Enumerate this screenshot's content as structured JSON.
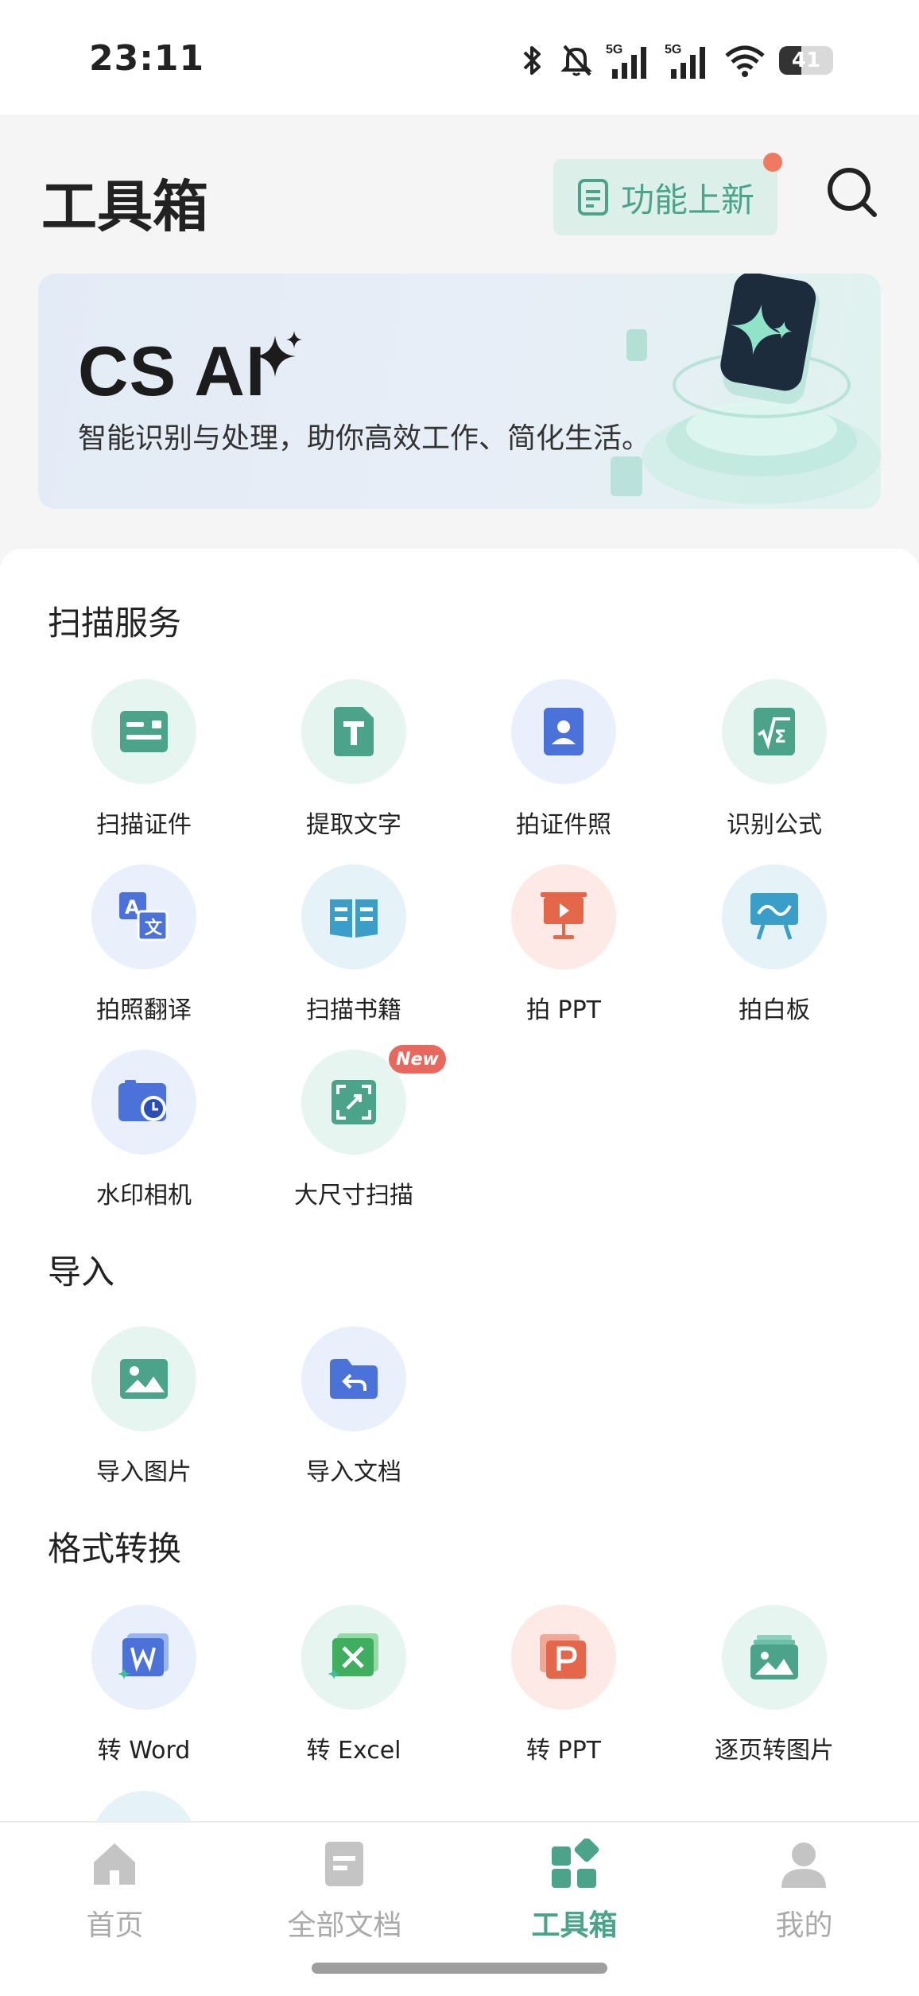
{
  "status_bar": {
    "time": "23:11",
    "battery": "41",
    "battery_level": 0.41,
    "network_1": "5G",
    "network_2": "5G",
    "icons": [
      "bluetooth-icon",
      "mute-icon",
      "signal-5g-icon",
      "signal-5g-icon",
      "wifi-icon",
      "battery-icon"
    ]
  },
  "header": {
    "title": "工具箱",
    "news_button": "功能上新",
    "news_dot_color": "#ef7a5f",
    "search_icon": "search-icon"
  },
  "banner": {
    "title": "CS AI",
    "subtitle": "智能识别与处理，助你高效工作、简化生活。"
  },
  "sections": {
    "scan": {
      "title": "扫描服务",
      "items": [
        {
          "label": "扫描证件",
          "icon": "id-card-icon"
        },
        {
          "label": "提取文字",
          "icon": "text-extract-icon"
        },
        {
          "label": "拍证件照",
          "icon": "id-photo-icon"
        },
        {
          "label": "识别公式",
          "icon": "formula-icon"
        },
        {
          "label": "拍照翻译",
          "icon": "translate-icon"
        },
        {
          "label": "扫描书籍",
          "icon": "book-icon"
        },
        {
          "label": "拍 PPT",
          "icon": "ppt-board-icon"
        },
        {
          "label": "拍白板",
          "icon": "whiteboard-icon"
        },
        {
          "label": "水印相机",
          "icon": "watermark-camera-icon"
        },
        {
          "label": "大尺寸扫描",
          "icon": "large-scan-icon",
          "badge": "New"
        }
      ]
    },
    "import": {
      "title": "导入",
      "items": [
        {
          "label": "导入图片",
          "icon": "image-icon"
        },
        {
          "label": "导入文档",
          "icon": "folder-import-icon"
        }
      ]
    },
    "convert": {
      "title": "格式转换",
      "items": [
        {
          "label": "转 Word",
          "icon": "word-icon"
        },
        {
          "label": "转 Excel",
          "icon": "excel-icon"
        },
        {
          "label": "转 PPT",
          "icon": "ppt-icon"
        },
        {
          "label": "逐页转图片",
          "icon": "pages-to-image-icon"
        }
      ]
    }
  },
  "bottom_nav": {
    "items": [
      {
        "label": "首页",
        "icon": "home-icon"
      },
      {
        "label": "全部文档",
        "icon": "document-icon"
      },
      {
        "label": "工具箱",
        "icon": "toolbox-icon",
        "active": true
      },
      {
        "label": "我的",
        "icon": "profile-icon"
      }
    ]
  },
  "colors": {
    "accent": "#4ba48a",
    "blue": "#4a72d8",
    "orange": "#e5674a",
    "badge": "#e8685d"
  }
}
